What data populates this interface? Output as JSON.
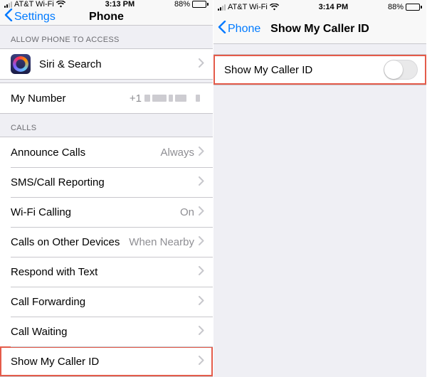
{
  "status": {
    "carrier": "AT&T Wi-Fi",
    "time_left": "3:13 PM",
    "time_right": "3:14 PM",
    "battery_pct": "88%",
    "battery_fill_pct": 88
  },
  "left": {
    "nav_back": "Settings",
    "nav_title": "Phone",
    "section_access": "ALLOW PHONE TO ACCESS",
    "siri_label": "Siri & Search",
    "my_number_label": "My Number",
    "my_number_prefix": "+1",
    "section_calls": "CALLS",
    "rows": {
      "announce": {
        "label": "Announce Calls",
        "value": "Always"
      },
      "sms": {
        "label": "SMS/Call Reporting",
        "value": ""
      },
      "wifi": {
        "label": "Wi-Fi Calling",
        "value": "On"
      },
      "other": {
        "label": "Calls on Other Devices",
        "value": "When Nearby"
      },
      "respond": {
        "label": "Respond with Text",
        "value": ""
      },
      "forward": {
        "label": "Call Forwarding",
        "value": ""
      },
      "waiting": {
        "label": "Call Waiting",
        "value": ""
      },
      "callerid": {
        "label": "Show My Caller ID",
        "value": ""
      }
    }
  },
  "right": {
    "nav_back": "Phone",
    "nav_title": "Show My Caller ID",
    "toggle_label": "Show My Caller ID",
    "toggle_on": false
  },
  "colors": {
    "accent": "#007aff",
    "highlight": "#e45b4a",
    "group_border": "#c8c7cc",
    "section_text": "#6d6d72",
    "value_text": "#8e8e93",
    "bg": "#efeff4"
  }
}
